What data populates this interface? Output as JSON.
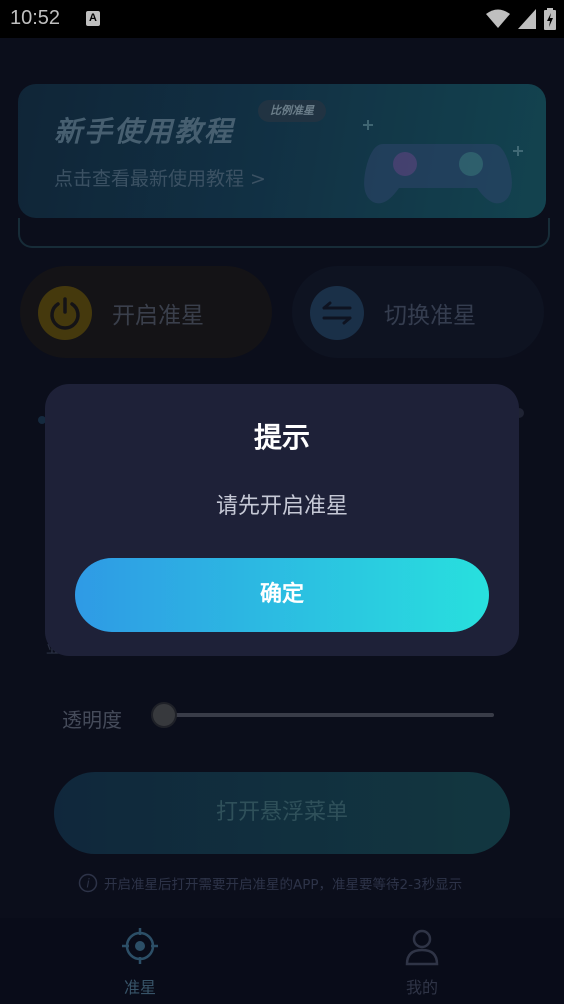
{
  "status_bar": {
    "time": "10:52",
    "notification_icon": "A"
  },
  "banner": {
    "title": "新手使用教程",
    "badge": "比例准星",
    "subtitle": "点击查看最新使用教程 >"
  },
  "controls": {
    "start_label": "开启准星",
    "switch_label": "切换准星"
  },
  "opacity": {
    "label": "透明度",
    "value": 0
  },
  "float_menu": {
    "label": "打开悬浮菜单"
  },
  "tip": {
    "text": "开启准星后打开需要开启准星的APP，准星要等待2-3秒显示"
  },
  "tabs": [
    {
      "label": "准星",
      "icon": "crosshair-icon",
      "active": true
    },
    {
      "label": "我的",
      "icon": "user-icon",
      "active": false
    }
  ],
  "dialog": {
    "title": "提示",
    "message": "请先开启准星",
    "ok_label": "确定"
  },
  "colors": {
    "accent_start": "#2f9ae5",
    "accent_end": "#28e0de",
    "dialog_bg": "#1e2138",
    "page_bg": "#0f1325"
  }
}
